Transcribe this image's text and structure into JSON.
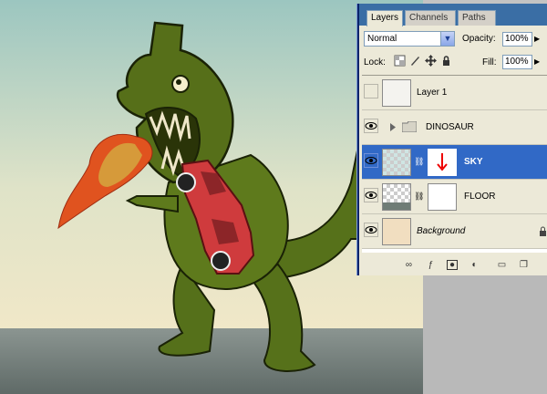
{
  "panel": {
    "tabs": [
      {
        "label": "Layers",
        "active": true
      },
      {
        "label": "Channels",
        "active": false
      },
      {
        "label": "Paths",
        "active": false
      }
    ],
    "blend_mode": "Normal",
    "opacity_label": "Opacity:",
    "opacity_value": "100%",
    "lock_label": "Lock:",
    "fill_label": "Fill:",
    "fill_value": "100%"
  },
  "layers": [
    {
      "name": "Layer 1",
      "visible": false,
      "selected": false,
      "italic": false
    },
    {
      "name": "DINOSAUR",
      "visible": true,
      "selected": false,
      "italic": false,
      "type": "group"
    },
    {
      "name": "SKY",
      "visible": true,
      "selected": true,
      "italic": false,
      "has_mask": true
    },
    {
      "name": "FLOOR",
      "visible": true,
      "selected": false,
      "italic": false,
      "has_mask": true
    },
    {
      "name": "Background",
      "visible": true,
      "selected": false,
      "italic": true,
      "locked": true
    }
  ],
  "icons": {
    "lock_icons": [
      "lock-transparent-pixels-icon",
      "lock-image-pixels-icon",
      "lock-position-icon",
      "lock-all-icon"
    ],
    "footer_icons": [
      "link-layers-icon",
      "layer-style-icon",
      "add-mask-icon",
      "adjustment-layer-icon",
      "new-group-icon",
      "new-layer-icon"
    ]
  },
  "colors": {
    "selection": "#3169c6",
    "panel_bg": "#ece9d8",
    "sky_top": "#9cc6c0",
    "sky_bottom": "#f2e8c8",
    "floor": "#707b77",
    "dino_green": "#4f6a14",
    "car_red": "#d23a3c",
    "fire_orange": "#e0531f"
  }
}
